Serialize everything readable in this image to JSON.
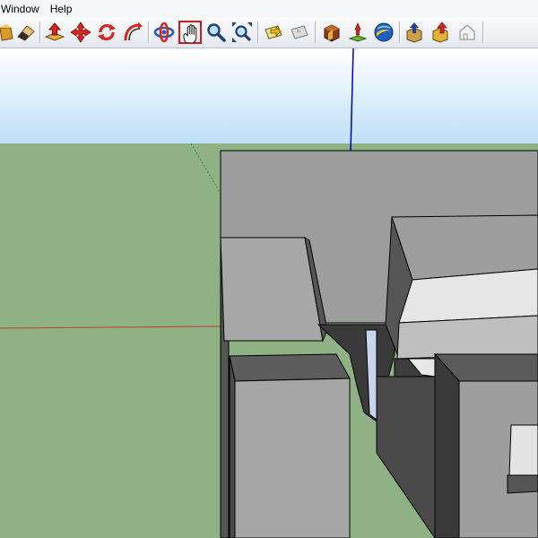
{
  "menu": {
    "window": "Window",
    "help": "Help"
  },
  "toolbar": {
    "buttons": [
      {
        "icon": "paint-bucket-icon"
      },
      {
        "icon": "eraser-icon"
      },
      {
        "icon": "push-pull-icon"
      },
      {
        "icon": "move-icon"
      },
      {
        "icon": "rotate-icon"
      },
      {
        "icon": "follow-me-icon"
      },
      {
        "icon": "orbit-icon"
      },
      {
        "icon": "pan-hand-icon",
        "active": true
      },
      {
        "icon": "zoom-icon"
      },
      {
        "icon": "zoom-extents-icon"
      },
      {
        "icon": "previous-view-icon"
      },
      {
        "icon": "next-view-icon"
      },
      {
        "icon": "get-models-icon"
      },
      {
        "icon": "place-model-icon"
      },
      {
        "icon": "google-earth-icon"
      },
      {
        "icon": "share-model-icon"
      },
      {
        "icon": "share-component-icon"
      },
      {
        "icon": "get-photo-texture-icon"
      }
    ]
  },
  "colors": {
    "sky_top": "#ffffff",
    "sky_bottom": "#bde0f6",
    "ground": "#8fb285",
    "accent_active": "#e0141c",
    "axis_blue": "#0000cc",
    "axis_red": "#b85030",
    "axis_green": "#3a8a3a"
  }
}
